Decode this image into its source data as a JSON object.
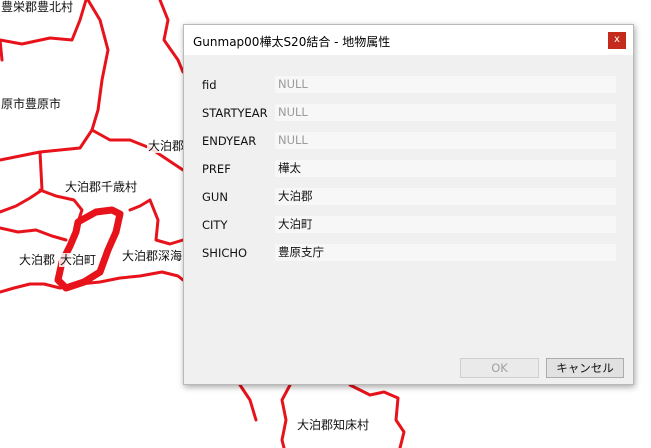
{
  "map": {
    "labels": {
      "toyosakae_toyokita": "豊栄郡豊北村",
      "toyohara_city": "原市豊原市",
      "odomari_gun": "大泊郡",
      "chitose_village": "大泊郡千歳村",
      "odomari_gun_2": "大泊郡",
      "odomari_town": "大泊町",
      "fukaumi": "大泊郡深海",
      "shiretoko": "大泊郡知床村"
    },
    "line_color": "#e8121b"
  },
  "dialog": {
    "title": "Gunmap00樺太S20結合 - 地物属性",
    "close_glyph": "x",
    "fields": [
      {
        "label": "fid",
        "value": "NULL"
      },
      {
        "label": "STARTYEAR",
        "value": "NULL"
      },
      {
        "label": "ENDYEAR",
        "value": "NULL"
      },
      {
        "label": "PREF",
        "value": "樺太"
      },
      {
        "label": "GUN",
        "value": "大泊郡"
      },
      {
        "label": "CITY",
        "value": "大泊町"
      },
      {
        "label": "SHICHO",
        "value": "豊原支庁"
      }
    ],
    "ok_label": "OK",
    "cancel_label": "キャンセル"
  }
}
